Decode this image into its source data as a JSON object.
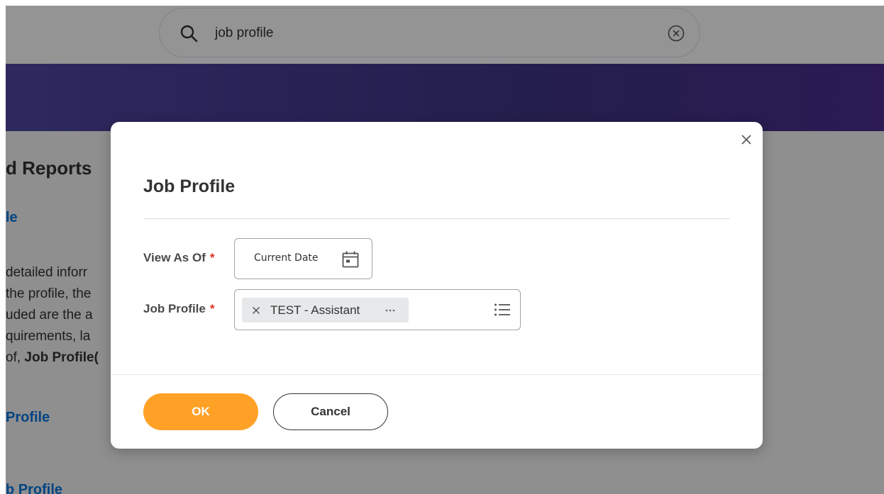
{
  "search": {
    "query": "job profile"
  },
  "background": {
    "heading": "d Reports",
    "link_1": "le",
    "description_lines": [
      "detailed inforr",
      "the profile, the",
      "uded are the a",
      "quirements, la"
    ],
    "description_last_prefix": "of, ",
    "description_last_bold": "Job Profile(",
    "link_2": "Profile",
    "link_3": "b Profile"
  },
  "modal": {
    "title": "Job Profile",
    "fields": {
      "view_as_of": {
        "label": "View As Of",
        "required_mark": "*",
        "value": "Current Date"
      },
      "job_profile": {
        "label": "Job Profile",
        "required_mark": "*",
        "selected": "TEST - Assistant"
      }
    },
    "buttons": {
      "ok": "OK",
      "cancel": "Cancel"
    }
  },
  "colors": {
    "primary_button": "#ffa126",
    "banner": "#3f3585",
    "link": "#0875e1",
    "required": "#de2e21"
  },
  "icons": {
    "search": "search-icon",
    "clear": "clear-search-icon",
    "close": "close-icon",
    "calendar": "calendar-icon",
    "remove": "remove-icon",
    "more": "more-icon",
    "prompt": "list-icon"
  }
}
